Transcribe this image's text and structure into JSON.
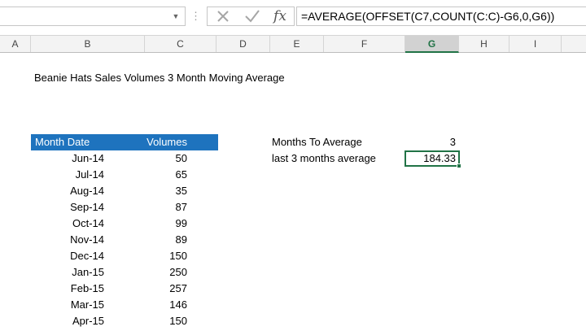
{
  "formula_bar": {
    "name_box": "",
    "fx_label": "fx",
    "formula": "=AVERAGE(OFFSET(C7,COUNT(C:C)-G6,0,G6))"
  },
  "columns": [
    "A",
    "B",
    "C",
    "D",
    "E",
    "F",
    "G",
    "H",
    "I"
  ],
  "selected_column": "G",
  "sheet": {
    "title": "Beanie Hats Sales Volumes 3 Month Moving Average",
    "table_headers": {
      "month_date": "Month Date",
      "volumes": "Volumes"
    },
    "rows": [
      {
        "date": "Jun-14",
        "volume": "50"
      },
      {
        "date": "Jul-14",
        "volume": "65"
      },
      {
        "date": "Aug-14",
        "volume": "35"
      },
      {
        "date": "Sep-14",
        "volume": "87"
      },
      {
        "date": "Oct-14",
        "volume": "99"
      },
      {
        "date": "Nov-14",
        "volume": "89"
      },
      {
        "date": "Dec-14",
        "volume": "150"
      },
      {
        "date": "Jan-15",
        "volume": "250"
      },
      {
        "date": "Feb-15",
        "volume": "257"
      },
      {
        "date": "Mar-15",
        "volume": "146"
      },
      {
        "date": "Apr-15",
        "volume": "150"
      }
    ],
    "months_to_average_label": "Months To Average",
    "months_to_average_value": "3",
    "last_avg_label": "last 3 months average",
    "last_avg_value": "184.33"
  },
  "colors": {
    "header_fill": "#1e73be",
    "selection": "#217346"
  }
}
